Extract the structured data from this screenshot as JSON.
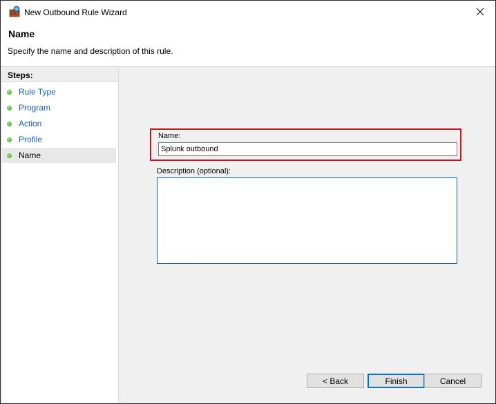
{
  "window": {
    "title": "New Outbound Rule Wizard"
  },
  "header": {
    "title": "Name",
    "subtitle": "Specify the name and description of this rule."
  },
  "steps": {
    "label": "Steps:",
    "items": [
      {
        "label": "Rule Type",
        "current": false
      },
      {
        "label": "Program",
        "current": false
      },
      {
        "label": "Action",
        "current": false
      },
      {
        "label": "Profile",
        "current": false
      },
      {
        "label": "Name",
        "current": true
      }
    ]
  },
  "form": {
    "name_label": "Name:",
    "name_value": "Splunk outbound",
    "description_label": "Description (optional):",
    "description_value": ""
  },
  "buttons": {
    "back": "< Back",
    "finish": "Finish",
    "cancel": "Cancel"
  },
  "colors": {
    "highlight_border": "#d0111c",
    "link": "#1a62b5",
    "step_dot": "#3f9e1d"
  }
}
